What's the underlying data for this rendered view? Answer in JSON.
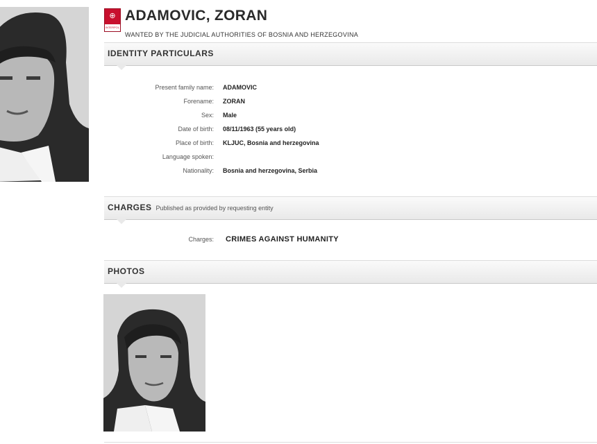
{
  "header": {
    "logo_text": "INTERPOL",
    "name": "ADAMOVIC, ZORAN",
    "wanted_by": "WANTED BY THE JUDICIAL AUTHORITIES OF BOSNIA AND HERZEGOVINA"
  },
  "identity": {
    "section_title": "IDENTITY PARTICULARS",
    "rows": [
      {
        "label": "Present family name:",
        "value": "ADAMOVIC"
      },
      {
        "label": "Forename:",
        "value": "ZORAN"
      },
      {
        "label": "Sex:",
        "value": "Male"
      },
      {
        "label": "Date of birth:",
        "value": "08/11/1963 (55 years old)"
      },
      {
        "label": "Place of birth:",
        "value": "KLJUC, Bosnia and herzegovina"
      },
      {
        "label": "Language spoken:",
        "value": ""
      },
      {
        "label": "Nationality:",
        "value": "Bosnia and herzegovina, Serbia"
      }
    ]
  },
  "charges": {
    "section_title": "CHARGES",
    "subtitle": "Published as provided by requesting entity",
    "label": "Charges:",
    "value": "CRIMES AGAINST HUMANITY"
  },
  "photos": {
    "section_title": "PHOTOS"
  },
  "colors": {
    "brand": "#c8102e",
    "section_bar": "#e9e9e9"
  }
}
